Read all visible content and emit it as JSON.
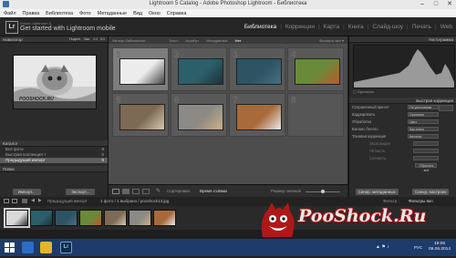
{
  "window": {
    "title": "Lightroom 5 Catalog - Adobe Photoshop Lightroom - Библиотека",
    "minimize": "–",
    "maximize": "□",
    "close": "✕"
  },
  "menu": [
    "Файл",
    "Правка",
    "Библиотека",
    "Фото",
    "Метаданные",
    "Вид",
    "Окно",
    "Справка"
  ],
  "identity": {
    "logo": "Lr",
    "small": "Adobe Lightroom 5",
    "big": "Get started with Lightroom mobile"
  },
  "modules": [
    "Библиотека",
    "Коррекции",
    "Карта",
    "Книга",
    "Слайд-шоу",
    "Печать",
    "Web"
  ],
  "left_panel": {
    "navigator": {
      "header": "Навигатор",
      "options": [
        "Подогн.",
        "Зап.",
        "1:1",
        "3:1"
      ]
    },
    "catalog": {
      "header": "Каталог",
      "items": [
        {
          "label": "Все фото",
          "count": "8"
        },
        {
          "label": "Быстрая коллекция +",
          "count": "0"
        },
        {
          "label": "Предыдущий импорт",
          "count": "8"
        }
      ]
    },
    "folders_header": "Папки",
    "import_button": "Импорт...",
    "export_button": "Экспорт..."
  },
  "filter_bar": {
    "left": "Фильтр библиотеки :",
    "options": [
      "Текст",
      "Атрибут",
      "Метаданные",
      "Нет"
    ],
    "right": "Фильтры вкл ▾"
  },
  "grid": {
    "cells": [
      {
        "num": "1",
        "selected": true,
        "color": "#ececec",
        "color2": "#444"
      },
      {
        "num": "2",
        "selected": false,
        "color": "#2c5f6a",
        "color2": "#1c3238"
      },
      {
        "num": "3",
        "selected": false,
        "color": "#2e5363",
        "color2": "#466f84"
      },
      {
        "num": "4",
        "selected": false,
        "color": "#6a8a3a",
        "color2": "#c05626"
      },
      {
        "num": "5",
        "selected": false,
        "color": "#7c6a55",
        "color2": "#d6c6b0"
      },
      {
        "num": "6",
        "selected": false,
        "color": "#8d8a85",
        "color2": "#c9b18a"
      },
      {
        "num": "7",
        "selected": false,
        "color": "#a86a3a",
        "color2": "#eaeaea"
      },
      {
        "num": "8",
        "selected": false,
        "color": "",
        "color2": ""
      }
    ]
  },
  "toolbar": {
    "sort_label": "Сортировка:",
    "sort_value": "Время съёмки",
    "thumbs_label": "Размер значков"
  },
  "right_panel": {
    "histogram_header": "Гистограмма",
    "original_photo": "Оригинал",
    "quick_develop_header": "Быстрая коррекция",
    "saved_preset_label": "Сохранённый пресет",
    "saved_preset_value": "По умолчанию",
    "crop_label": "Кадрировать",
    "crop_value": "Оригинал",
    "treatment_label": "Обработка",
    "treatment_value": "Цвет",
    "wb_label": "Баланс белого",
    "wb_value": "Как снято",
    "tone_label": "Тоновая коррекция",
    "tone_value": "Автотон",
    "exposure_label": "Экспозиция",
    "clarity_label": "Чёткость",
    "vibrance_label": "Сочность",
    "reset_button": "Сбросить всё",
    "sync_meta": "Синхр. метаданных",
    "sync_settings": "Синхр. настроек"
  },
  "filmstrip": {
    "source": "Предыдущий импорт",
    "info": "1 фото / 1 выбрано / pooshock13.jpg",
    "filter_label": "Фильтр :",
    "filter_value": "Фильтры вкл",
    "thumbs": [
      {
        "color": "#d9d9d9",
        "color2": "#333"
      },
      {
        "color": "#2c5f6a",
        "color2": "#1c3238"
      },
      {
        "color": "#2e5363",
        "color2": "#466f84"
      },
      {
        "color": "#6a8a3a",
        "color2": "#c05626"
      },
      {
        "color": "#7c6a55",
        "color2": "#d6c6b0"
      },
      {
        "color": "#8d8a85",
        "color2": "#c9b18a"
      },
      {
        "color": "#a86a3a",
        "color2": "#eaeaea"
      }
    ]
  },
  "watermark": {
    "text": "PooShock.Ru",
    "image_caption": "POOSHOCK.RU"
  },
  "taskbar": {
    "lang": "РУС",
    "time": "19:06",
    "date": "09.06.2014"
  }
}
